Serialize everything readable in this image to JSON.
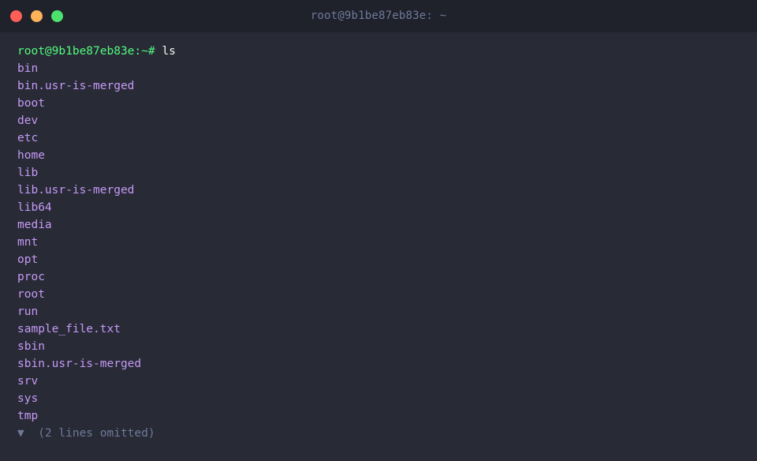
{
  "window": {
    "title": "root@9b1be87eb83e: ~"
  },
  "terminal": {
    "prompt": "root@9b1be87eb83e:~#",
    "command": "ls",
    "entries": [
      "bin",
      "bin.usr-is-merged",
      "boot",
      "dev",
      "etc",
      "home",
      "lib",
      "lib.usr-is-merged",
      "lib64",
      "media",
      "mnt",
      "opt",
      "proc",
      "root",
      "run",
      "sample_file.txt",
      "sbin",
      "sbin.usr-is-merged",
      "srv",
      "sys",
      "tmp"
    ],
    "omitted_label": "▼  (2 lines omitted)"
  },
  "colors": {
    "background": "#282a36",
    "titlebar": "#1f212b",
    "prompt": "#50fa7b",
    "entry": "#c59af5",
    "muted": "#6f7b99",
    "close": "#ff5f57",
    "minimize": "#fdb35a",
    "maximize": "#4de26e"
  }
}
